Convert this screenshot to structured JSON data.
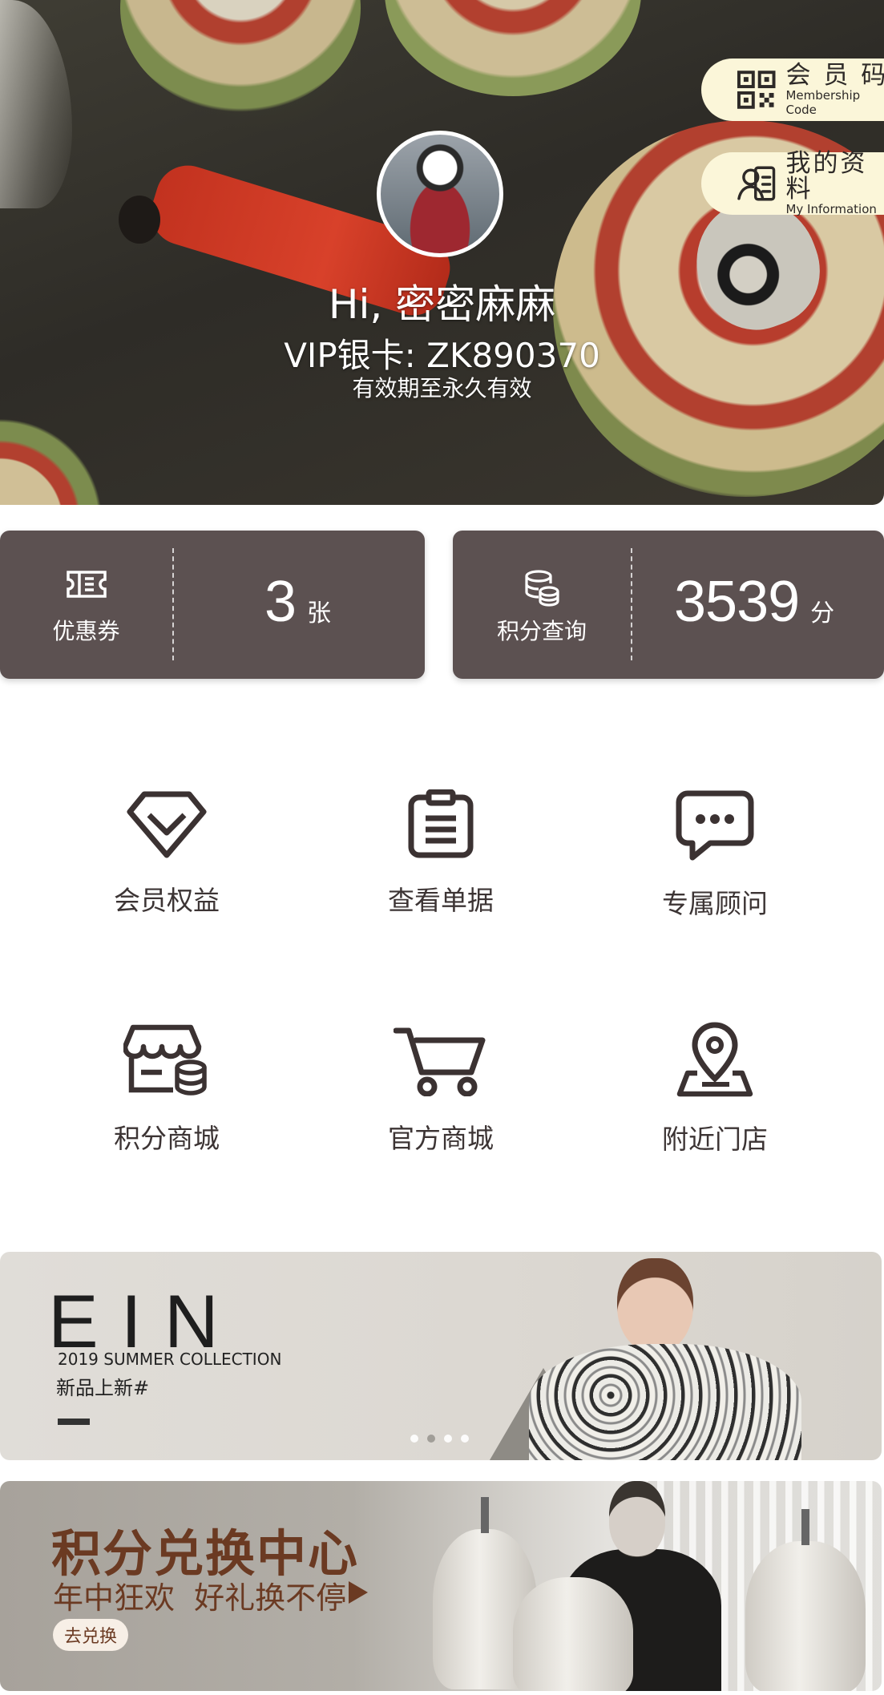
{
  "hero": {
    "greeting": "Hi, 密密麻麻",
    "card_no": "VIP银卡: ZK890370",
    "validity": "有效期至永久有效",
    "membership_code": {
      "title": "会 员 码",
      "subtitle": "Membership Code",
      "icon": "qr-code-icon"
    },
    "my_info": {
      "title": "我的资料",
      "subtitle": "My  Information",
      "icon": "user-card-icon"
    }
  },
  "stats": {
    "coupons": {
      "label": "优惠券",
      "value": "3",
      "unit": "张",
      "icon": "ticket-icon"
    },
    "points": {
      "label": "积分查询",
      "value": "3539",
      "unit": "分",
      "icon": "coin-stack-icon"
    }
  },
  "menu": [
    {
      "label": "会员权益",
      "icon": "diamond-icon"
    },
    {
      "label": "查看单据",
      "icon": "clipboard-icon"
    },
    {
      "label": "专属顾问",
      "icon": "chat-icon"
    },
    {
      "label": "积分商城",
      "icon": "shop-coins-icon"
    },
    {
      "label": "官方商城",
      "icon": "cart-icon"
    },
    {
      "label": "附近门店",
      "icon": "map-pin-icon"
    }
  ],
  "banner1": {
    "brand": "EIN",
    "collection": "2019 SUMMER COLLECTION",
    "tagline": "新品上新#",
    "carousel_active": 2,
    "carousel_count": 4
  },
  "banner2": {
    "title": "积分兑换中心",
    "subtitle": "年中狂欢  好礼换不停",
    "button": "去兑换"
  },
  "colors": {
    "card_bg": "#5c5151",
    "side_button_bg": "#fbf6d9",
    "icon_stroke": "#3b3232",
    "promo_brown": "#6b3a22"
  }
}
